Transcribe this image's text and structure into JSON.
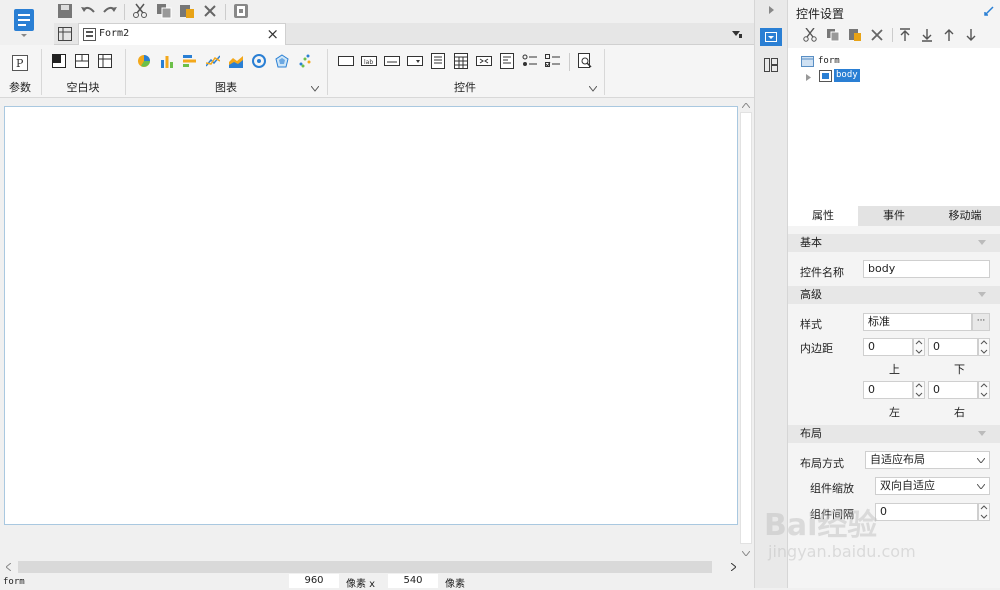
{
  "toolbar": {
    "icons": [
      "app-menu-icon",
      "save-icon",
      "undo-icon",
      "redo-icon",
      "cut-icon",
      "copy-icon",
      "paste-icon",
      "delete-icon",
      "template-icon"
    ]
  },
  "tabs": {
    "home_icon": "grid-icon",
    "doc_label": "Form2",
    "close": "×"
  },
  "ribbon": {
    "param_label": "参数",
    "blank_label": "空白块",
    "chart_label": "图表",
    "control_label": "控件",
    "param_glyph": "P"
  },
  "canvas": {
    "width": "960",
    "unit1": "像素 x",
    "height": "540",
    "unit2": "像素"
  },
  "status": {
    "path": "form"
  },
  "right_panel": {
    "title": "控件设置",
    "tree_root": "form",
    "tree_child": "body",
    "tabs": [
      "属性",
      "事件",
      "移动端"
    ],
    "active_tab": 0,
    "sections": {
      "basic": "基本",
      "advanced": "高级",
      "layout": "布局"
    },
    "fields": {
      "name_label": "控件名称",
      "name_value": "body",
      "style_label": "样式",
      "style_value": "标准",
      "style_more": "···",
      "padding_label": "内边距",
      "pad_top": "0",
      "pad_bottom": "0",
      "pad_left": "0",
      "pad_right": "0",
      "pad_top_label": "上",
      "pad_bottom_label": "下",
      "pad_left_label": "左",
      "pad_right_label": "右",
      "layout_mode_label": "布局方式",
      "layout_mode_value": "自适应布局",
      "scale_label": "组件缩放",
      "scale_value": "双向自适应",
      "gap_label": "组件间隔",
      "gap_value": "0"
    }
  },
  "watermark": {
    "logo_text": "Bai经验",
    "url": "jingyan.baidu.com"
  },
  "colors": {
    "accent": "#2a7fd4",
    "canvas_border": "#a9c8e0"
  }
}
